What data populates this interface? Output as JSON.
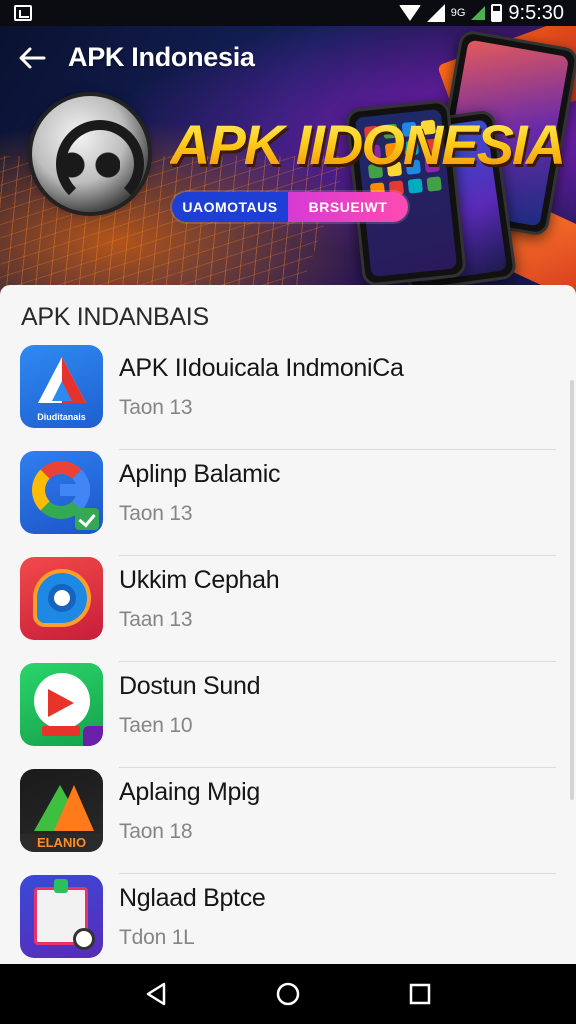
{
  "status_bar": {
    "time": "9:5:30",
    "network": "9G",
    "icons": [
      "notification-icon",
      "wifi-icon",
      "signal-icon",
      "battery-icon"
    ]
  },
  "header": {
    "title": "APK Indonesia",
    "back_icon": "arrow-left-icon"
  },
  "banner": {
    "heading": "APK IIDONESIA",
    "pill_left": "UAOMOTAUS",
    "pill_right": "BRSUEIWT"
  },
  "section": {
    "title": "APK INDANBAIS"
  },
  "apps": [
    {
      "name": "APK IIdouicala IndmoniCa",
      "meta": "Taon 13",
      "icon": "triangle-app-icon",
      "icon_caption": "Diuditanais"
    },
    {
      "name": "Aplinp Balamic",
      "meta": "Taon 13",
      "icon": "g-check-app-icon"
    },
    {
      "name": "Ukkim Cephah",
      "meta": "Taan 13",
      "icon": "ring-app-icon"
    },
    {
      "name": "Dostun Sund",
      "meta": "Taen 10",
      "icon": "play-app-icon"
    },
    {
      "name": "Aplaing Mpig",
      "meta": "Taon 18",
      "icon": "x-app-icon",
      "icon_caption": "ELANIO"
    },
    {
      "name": "Nglaad Bptce",
      "meta": "Tdon 1L",
      "icon": "notes-app-icon"
    }
  ],
  "nav": {
    "back": "back-triangle-icon",
    "home": "home-circle-icon",
    "recents": "recents-square-icon"
  },
  "colors": {
    "banner_heading": "#ffd21f",
    "pill_left": "#1d3fd6",
    "pill_right": "#d63ad6",
    "card_bg": "#f6f6f6"
  }
}
